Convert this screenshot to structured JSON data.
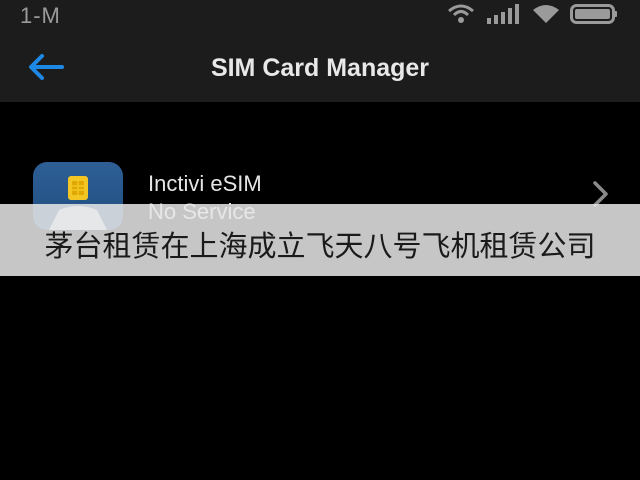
{
  "status_bar": {
    "time": "1-M",
    "icons": [
      "hotspot-icon",
      "cell-signal-icon",
      "wifi-icon",
      "battery-icon"
    ]
  },
  "header": {
    "title": "SIM Card Manager",
    "back_icon": "back-arrow-icon"
  },
  "sim_list": [
    {
      "name": "Inctivi eSIM",
      "status": "No Service",
      "icon": "sim-card-icon"
    }
  ],
  "watermark": {
    "text": "茅台租赁在上海成立飞天八号飞机租赁公司"
  },
  "colors": {
    "background": "#000000",
    "bar_background": "#1c1c1c",
    "accent": "#1e88e5",
    "text": "#e6e6e6",
    "icon_tile": "#2e5f95"
  }
}
